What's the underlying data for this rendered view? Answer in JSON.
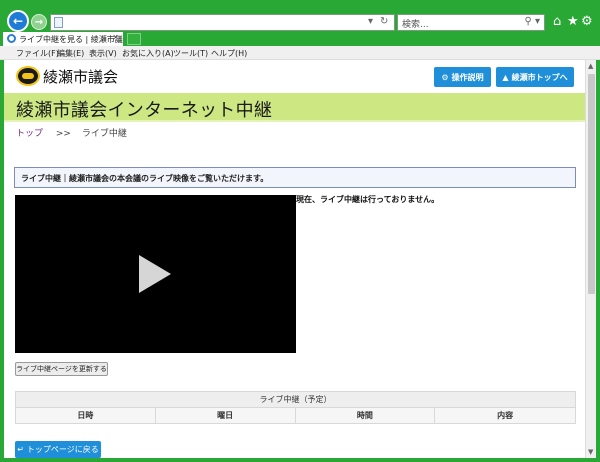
{
  "browser": {
    "address_url": "",
    "search_placeholder": "検索...",
    "tab_title": "ライブ中継を見る | 綾瀬市議...",
    "menu": [
      "ファイル(F)",
      "編集(E)",
      "表示(V)",
      "お気に入り(A)",
      "ツール(T)",
      "ヘルプ(H)"
    ]
  },
  "site": {
    "name": "綾瀬市議会",
    "help_button": "操作説明",
    "city_top_button": "綾瀬市トップへ",
    "banner_title": "綾瀬市議会インターネット中継"
  },
  "breadcrumb": {
    "home": "トップ",
    "sep": ">>",
    "current": "ライブ中継"
  },
  "notice": "ライブ中継｜綾瀬市議会の本会議のライブ映像をご覧いただけます。",
  "status": "現在、ライブ中継は行っておりません。",
  "refresh_button": "ライブ中継ページを更新する",
  "schedule": {
    "caption": "ライブ中継（予定）",
    "columns": [
      "日時",
      "曜日",
      "時間",
      "内容"
    ]
  },
  "back_to_top": "トップページに戻る"
}
